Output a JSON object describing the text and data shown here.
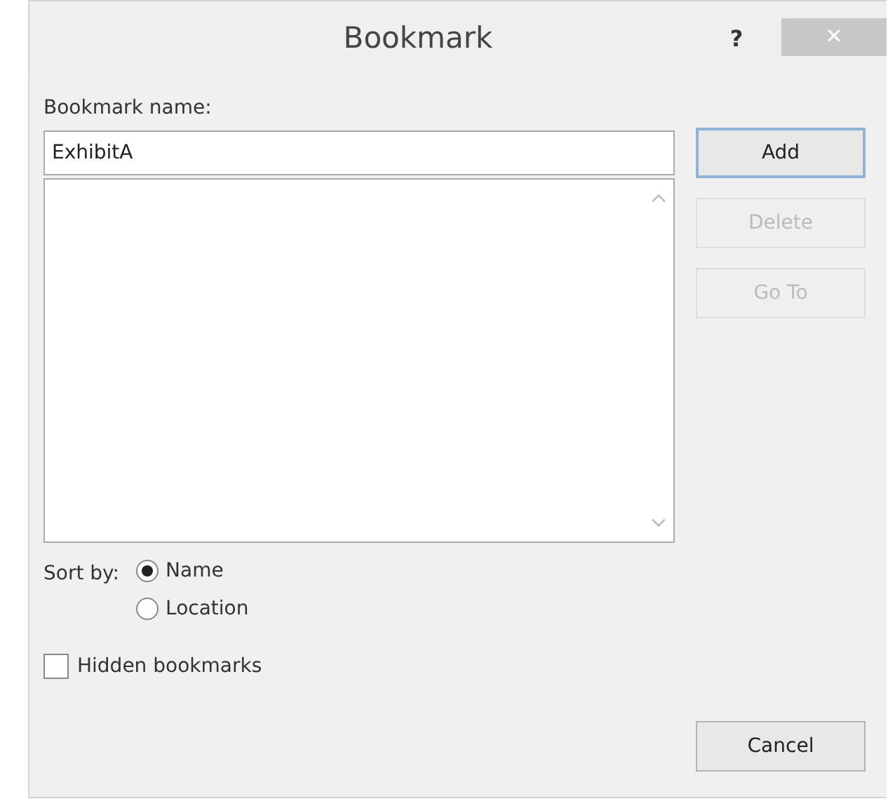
{
  "window": {
    "title": "Bookmark",
    "help": "?",
    "close": "×"
  },
  "name_label": "Bookmark name:",
  "name_field": {
    "value": "ExhibitA"
  },
  "buttons": [
    {
      "label": "Add",
      "disabled": false,
      "focused": true
    },
    {
      "label": "Delete",
      "disabled": true,
      "focused": false
    },
    {
      "label": "Go To",
      "disabled": true,
      "focused": false
    }
  ],
  "sort_label": "Sort by:",
  "sort_options": [
    {
      "label": "Name",
      "selected": true
    },
    {
      "label": "Location",
      "selected": false
    }
  ],
  "hidden_bookmarks": {
    "label": "Hidden bookmarks",
    "checked": false
  },
  "cancel": {
    "label": "Cancel"
  }
}
